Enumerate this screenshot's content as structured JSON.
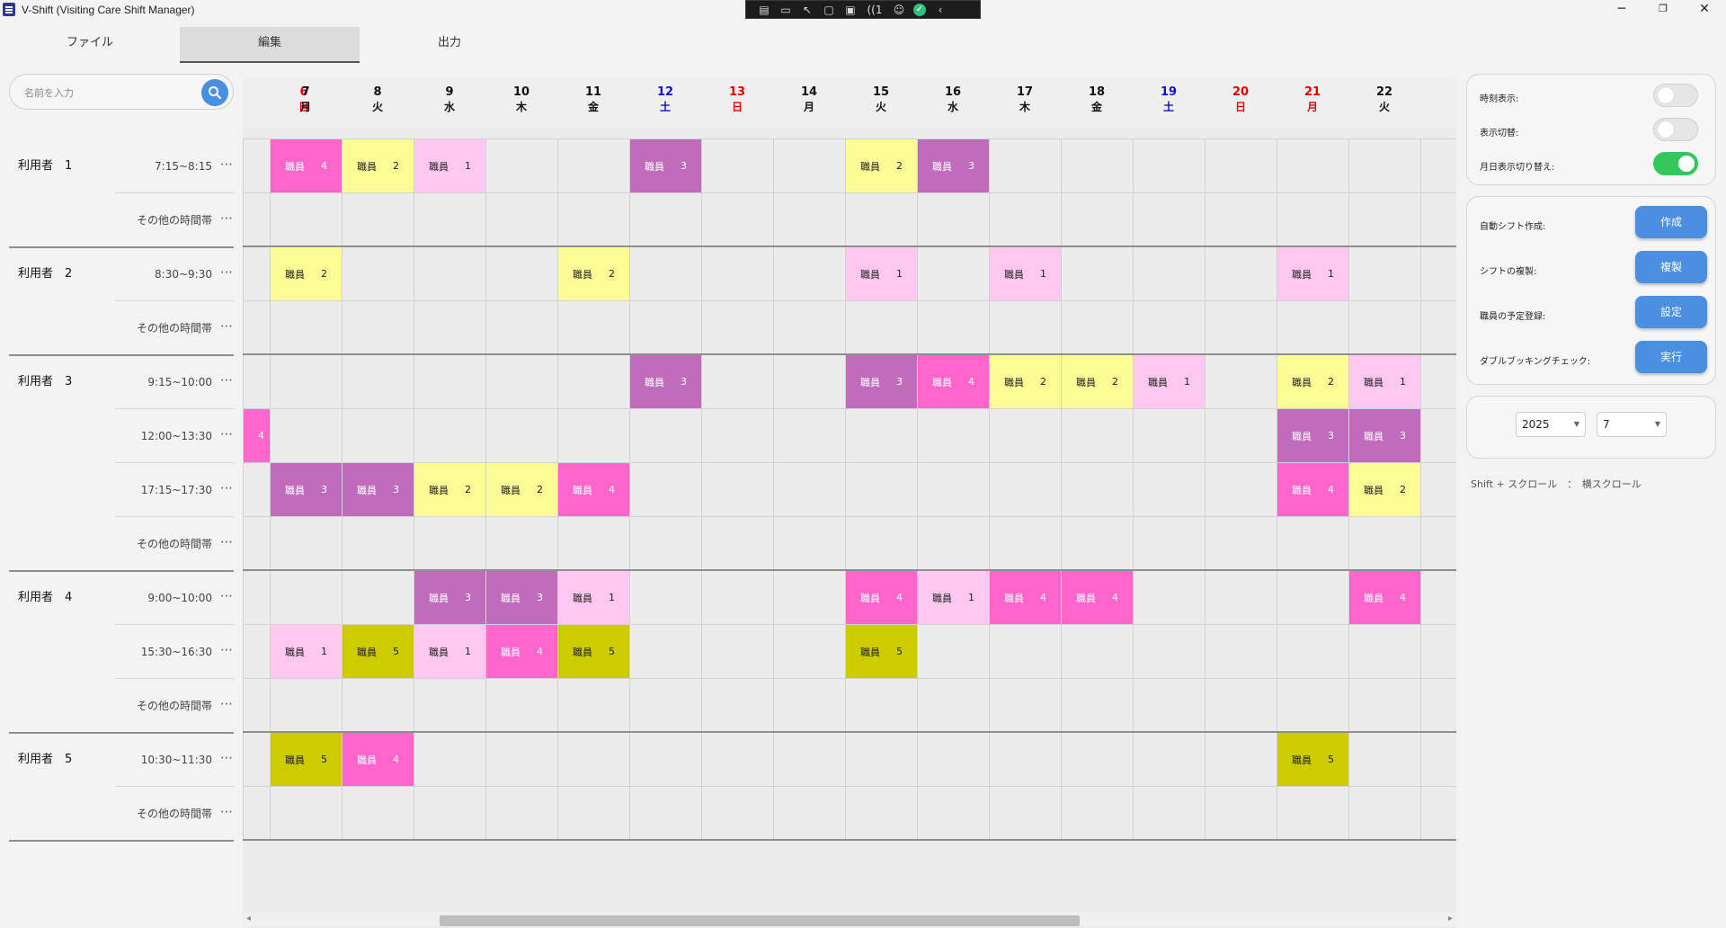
{
  "window": {
    "title": "V-Shift  (Visiting Care Shift Manager)",
    "minimize_glyph": "─",
    "maximize_glyph": "❐",
    "close_glyph": "✕"
  },
  "remote_toolbar": {
    "icons": [
      "doc-icon",
      "camera-icon",
      "pointer-icon",
      "frame-icon",
      "monitor-icon",
      "signal-icon",
      "accessibility-icon",
      "check-icon",
      "chevron-left-icon"
    ],
    "signal_text": "1"
  },
  "tabs": [
    {
      "label": "ファイル",
      "active": false
    },
    {
      "label": "編集",
      "active": true
    },
    {
      "label": "出力",
      "active": false
    }
  ],
  "search": {
    "placeholder": "名前を入力",
    "value": ""
  },
  "dates": [
    {
      "day": "6",
      "weekday": "日",
      "color": "#e00000"
    },
    {
      "day": "7",
      "weekday": "月",
      "color": "#111111"
    },
    {
      "day": "8",
      "weekday": "火",
      "color": "#111111"
    },
    {
      "day": "9",
      "weekday": "水",
      "color": "#111111"
    },
    {
      "day": "10",
      "weekday": "木",
      "color": "#111111"
    },
    {
      "day": "11",
      "weekday": "金",
      "color": "#111111"
    },
    {
      "day": "12",
      "weekday": "土",
      "color": "#1010d0"
    },
    {
      "day": "13",
      "weekday": "日",
      "color": "#e00000"
    },
    {
      "day": "14",
      "weekday": "月",
      "color": "#111111"
    },
    {
      "day": "15",
      "weekday": "火",
      "color": "#111111"
    },
    {
      "day": "16",
      "weekday": "水",
      "color": "#111111"
    },
    {
      "day": "17",
      "weekday": "木",
      "color": "#111111"
    },
    {
      "day": "18",
      "weekday": "金",
      "color": "#111111"
    },
    {
      "day": "19",
      "weekday": "土",
      "color": "#1010d0"
    },
    {
      "day": "20",
      "weekday": "日",
      "color": "#e00000"
    },
    {
      "day": "21",
      "weekday": "月",
      "color": "#e00000"
    },
    {
      "day": "22",
      "weekday": "火",
      "color": "#111111"
    }
  ],
  "users": [
    {
      "name": "利用者　1",
      "slots": [
        {
          "time": "7:15~8:15"
        },
        {
          "time": "その他の時間帯"
        }
      ]
    },
    {
      "name": "利用者　2",
      "slots": [
        {
          "time": "8:30~9:30"
        },
        {
          "time": "その他の時間帯"
        }
      ]
    },
    {
      "name": "利用者　3",
      "slots": [
        {
          "time": "9:15~10:00"
        },
        {
          "time": "12:00~13:30"
        },
        {
          "time": "17:15~17:30"
        },
        {
          "time": "その他の時間帯"
        }
      ]
    },
    {
      "name": "利用者　4",
      "slots": [
        {
          "time": "9:00~10:00"
        },
        {
          "time": "15:30~16:30"
        },
        {
          "time": "その他の時間帯"
        }
      ]
    },
    {
      "name": "利用者　5",
      "slots": [
        {
          "time": "10:30~11:30"
        },
        {
          "time": "その他の時間帯"
        }
      ]
    }
  ],
  "more_glyph": "⋯",
  "staff_colors": {
    "1": "#ffc8f0",
    "2": "#fdfd96",
    "3": "#c06cba",
    "4": "#ff66cc",
    "5": "#cccc00"
  },
  "staff_label": "職員",
  "shifts": [
    {
      "row": 0,
      "col": 1,
      "staff": "4"
    },
    {
      "row": 0,
      "col": 2,
      "staff": "2"
    },
    {
      "row": 0,
      "col": 3,
      "staff": "1"
    },
    {
      "row": 0,
      "col": 6,
      "staff": "3"
    },
    {
      "row": 0,
      "col": 9,
      "staff": "2"
    },
    {
      "row": 0,
      "col": 10,
      "staff": "3"
    },
    {
      "row": 2,
      "col": 1,
      "staff": "2"
    },
    {
      "row": 2,
      "col": 5,
      "staff": "2"
    },
    {
      "row": 2,
      "col": 9,
      "staff": "1"
    },
    {
      "row": 2,
      "col": 11,
      "staff": "1"
    },
    {
      "row": 2,
      "col": 15,
      "staff": "1"
    },
    {
      "row": 4,
      "col": 6,
      "staff": "3"
    },
    {
      "row": 4,
      "col": 9,
      "staff": "3"
    },
    {
      "row": 4,
      "col": 10,
      "staff": "4"
    },
    {
      "row": 4,
      "col": 11,
      "staff": "2"
    },
    {
      "row": 4,
      "col": 12,
      "staff": "2"
    },
    {
      "row": 4,
      "col": 13,
      "staff": "1"
    },
    {
      "row": 4,
      "col": 15,
      "staff": "2"
    },
    {
      "row": 4,
      "col": 16,
      "staff": "1"
    },
    {
      "row": 5,
      "col": 0,
      "staff": "4"
    },
    {
      "row": 5,
      "col": 15,
      "staff": "3"
    },
    {
      "row": 5,
      "col": 16,
      "staff": "3"
    },
    {
      "row": 6,
      "col": 1,
      "staff": "3"
    },
    {
      "row": 6,
      "col": 2,
      "staff": "3"
    },
    {
      "row": 6,
      "col": 3,
      "staff": "2"
    },
    {
      "row": 6,
      "col": 4,
      "staff": "2"
    },
    {
      "row": 6,
      "col": 5,
      "staff": "4"
    },
    {
      "row": 6,
      "col": 15,
      "staff": "4"
    },
    {
      "row": 6,
      "col": 16,
      "staff": "2"
    },
    {
      "row": 8,
      "col": 3,
      "staff": "3"
    },
    {
      "row": 8,
      "col": 4,
      "staff": "3"
    },
    {
      "row": 8,
      "col": 5,
      "staff": "1"
    },
    {
      "row": 8,
      "col": 9,
      "staff": "4"
    },
    {
      "row": 8,
      "col": 10,
      "staff": "1"
    },
    {
      "row": 8,
      "col": 11,
      "staff": "4"
    },
    {
      "row": 8,
      "col": 12,
      "staff": "4"
    },
    {
      "row": 8,
      "col": 16,
      "staff": "4"
    },
    {
      "row": 9,
      "col": 1,
      "staff": "1"
    },
    {
      "row": 9,
      "col": 2,
      "staff": "5"
    },
    {
      "row": 9,
      "col": 3,
      "staff": "1"
    },
    {
      "row": 9,
      "col": 4,
      "staff": "4"
    },
    {
      "row": 9,
      "col": 5,
      "staff": "5"
    },
    {
      "row": 9,
      "col": 9,
      "staff": "5"
    },
    {
      "row": 11,
      "col": 1,
      "staff": "5"
    },
    {
      "row": 11,
      "col": 2,
      "staff": "4"
    },
    {
      "row": 11,
      "col": 15,
      "staff": "5"
    }
  ],
  "options": [
    {
      "label": "時刻表示:",
      "on": false
    },
    {
      "label": "表示切替:",
      "on": false
    },
    {
      "label": "月日表示切り替え:",
      "on": true
    }
  ],
  "actions": [
    {
      "label": "自動シフト作成:",
      "button": "作成"
    },
    {
      "label": "シフトの複製:",
      "button": "複製"
    },
    {
      "label": "職員の予定登録:",
      "button": "設定"
    },
    {
      "label": "ダブルブッキングチェック:",
      "button": "実行"
    }
  ],
  "period": {
    "year": "2025",
    "month": "7"
  },
  "hint": "Shift + スクロール　：　横スクロール",
  "scroll": {
    "left_arrow": "◂",
    "right_arrow": "▸"
  }
}
